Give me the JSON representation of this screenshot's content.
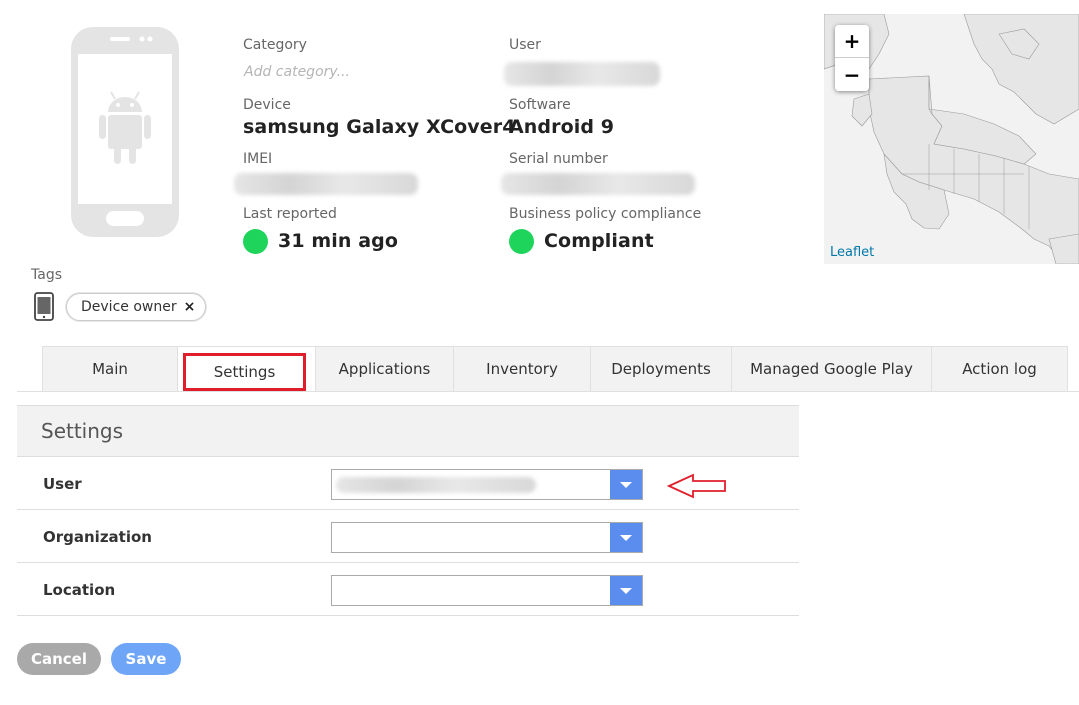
{
  "device_info": {
    "category_label": "Category",
    "category_placeholder": "Add category...",
    "user_label": "User",
    "device_label": "Device",
    "device_value": "samsung Galaxy XCover4",
    "software_label": "Software",
    "software_value": "Android 9",
    "imei_label": "IMEI",
    "serial_label": "Serial number",
    "last_reported_label": "Last reported",
    "last_reported_value": "31 min ago",
    "compliance_label": "Business policy compliance",
    "compliance_value": "Compliant",
    "status_color": "#1ed45b"
  },
  "map": {
    "zoom_in": "+",
    "zoom_out": "−",
    "attribution": "Leaflet"
  },
  "tags": {
    "label": "Tags",
    "icon": "phone-icon",
    "items": [
      {
        "label": "Device owner",
        "remove": "×"
      }
    ]
  },
  "tabs": [
    {
      "label": "Main"
    },
    {
      "label": "Settings",
      "active": true
    },
    {
      "label": "Applications"
    },
    {
      "label": "Inventory"
    },
    {
      "label": "Deployments"
    },
    {
      "label": "Managed Google Play"
    },
    {
      "label": "Action log"
    }
  ],
  "settings": {
    "title": "Settings",
    "fields": [
      {
        "label": "User",
        "value_redacted": true
      },
      {
        "label": "Organization",
        "value": ""
      },
      {
        "label": "Location",
        "value": ""
      }
    ]
  },
  "buttons": {
    "cancel": "Cancel",
    "save": "Save"
  },
  "colors": {
    "accent": "#5b8def",
    "highlight": "#e01e2b",
    "save": "#6ea5f7",
    "cancel": "#a9a9a9"
  }
}
